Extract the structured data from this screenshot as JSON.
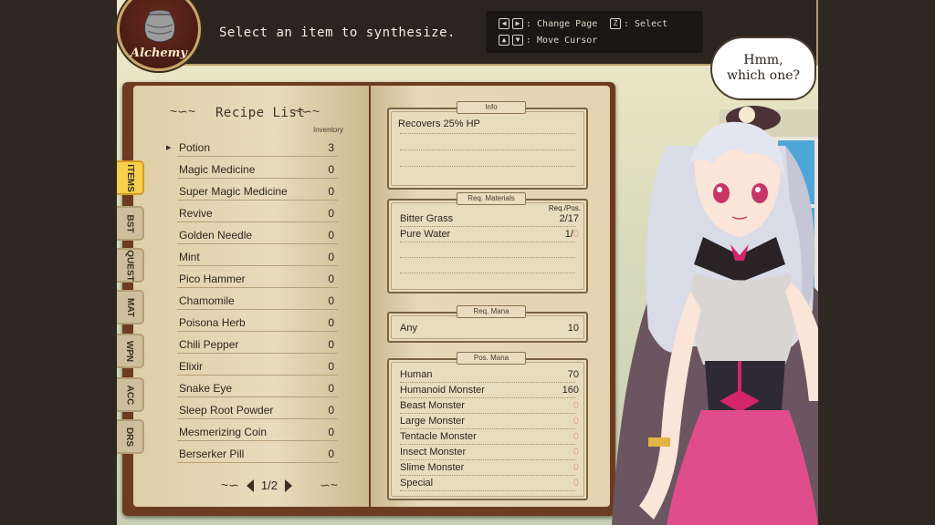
{
  "header": {
    "instruction": "Select an item to synthesize.",
    "controls": [
      {
        "keys": [
          "◀",
          "▶"
        ],
        "label": ": Change Page"
      },
      {
        "keys": [
          "Z"
        ],
        "label": ": Select"
      },
      {
        "keys": [
          "▲",
          "▼"
        ],
        "label": ": Move Cursor"
      }
    ]
  },
  "emblem": {
    "label": "Alchemy",
    "icon": "pot-icon"
  },
  "speech_bubble": {
    "line1": "Hmm,",
    "line2": "which one?"
  },
  "tabs": [
    {
      "label": "ITEMS",
      "active": true
    },
    {
      "label": "BST",
      "active": false
    },
    {
      "label": "QUEST",
      "active": false
    },
    {
      "label": "MAT",
      "active": false
    },
    {
      "label": "WPN",
      "active": false
    },
    {
      "label": "ACC",
      "active": false
    },
    {
      "label": "DRS",
      "active": false
    }
  ],
  "recipe_list": {
    "title": "Recipe List",
    "inventory_header": "Inventory",
    "items": [
      {
        "name": "Potion",
        "qty": "3",
        "selected": true
      },
      {
        "name": "Magic Medicine",
        "qty": "0"
      },
      {
        "name": "Super Magic Medicine",
        "qty": "0"
      },
      {
        "name": "Revive",
        "qty": "0"
      },
      {
        "name": "Golden Needle",
        "qty": "0"
      },
      {
        "name": "Mint",
        "qty": "0"
      },
      {
        "name": "Pico Hammer",
        "qty": "0"
      },
      {
        "name": "Chamomile",
        "qty": "0"
      },
      {
        "name": "Poisona Herb",
        "qty": "0"
      },
      {
        "name": "Chili Pepper",
        "qty": "0"
      },
      {
        "name": "Elixir",
        "qty": "0"
      },
      {
        "name": "Snake Eye",
        "qty": "0"
      },
      {
        "name": "Sleep Root Powder",
        "qty": "0"
      },
      {
        "name": "Mesmerizing Coin",
        "qty": "0"
      },
      {
        "name": "Berserker Pill",
        "qty": "0"
      }
    ],
    "page": "1/2"
  },
  "info": {
    "label": "Info",
    "description": "Recovers 25% HP"
  },
  "req_materials": {
    "label": "Req. Materials",
    "column_header": "Req./Pos.",
    "items": [
      {
        "name": "Bitter Grass",
        "value": "2/17",
        "pos_zero": false
      },
      {
        "name": "Pure Water",
        "value": "1/",
        "pos": "0",
        "pos_zero": true
      }
    ]
  },
  "req_mana": {
    "label": "Req. Mana",
    "name": "Any",
    "value": "10"
  },
  "pos_mana": {
    "label": "Pos. Mana",
    "items": [
      {
        "name": "Human",
        "value": "70"
      },
      {
        "name": "Humanoid Monster",
        "value": "160"
      },
      {
        "name": "Beast Monster",
        "value": "0"
      },
      {
        "name": "Large Monster",
        "value": "0"
      },
      {
        "name": "Tentacle Monster",
        "value": "0"
      },
      {
        "name": "Insect Monster",
        "value": "0"
      },
      {
        "name": "Slime Monster",
        "value": "0"
      },
      {
        "name": "Special",
        "value": "0"
      }
    ]
  }
}
